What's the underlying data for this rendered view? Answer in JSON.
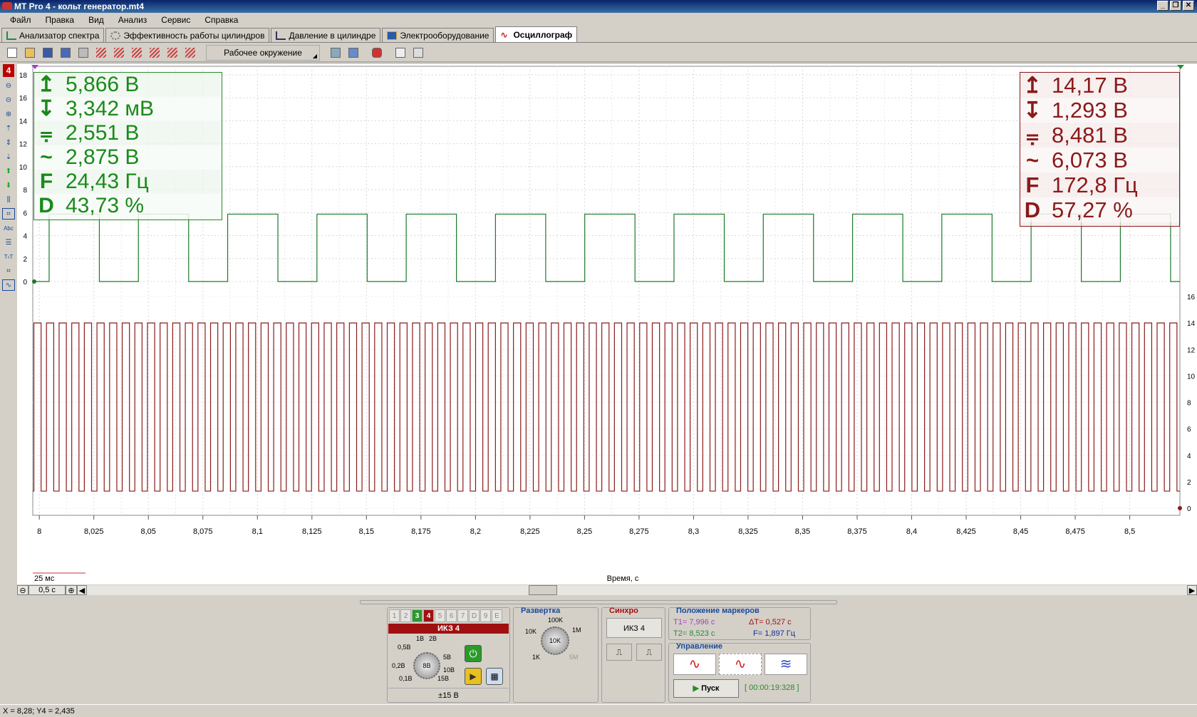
{
  "window": {
    "title": "MT Pro 4 - кольт генератор.mt4",
    "controls": [
      "_",
      "❐",
      "✕"
    ]
  },
  "menu": [
    "Файл",
    "Правка",
    "Вид",
    "Анализ",
    "Сервис",
    "Справка"
  ],
  "tabs": [
    {
      "label": "Анализатор спектра",
      "icon": "spectrum-icon",
      "active": false
    },
    {
      "label": "Эффективность работы цилиндров",
      "icon": "cylinder-efficiency-icon",
      "active": false
    },
    {
      "label": "Давление в цилиндре",
      "icon": "pressure-icon",
      "active": false
    },
    {
      "label": "Электрооборудование",
      "icon": "electrical-icon",
      "active": false
    },
    {
      "label": "Осциллограф",
      "icon": "oscilloscope-icon",
      "active": true
    }
  ],
  "toolbar": {
    "environment": "Рабочее окружение"
  },
  "left_badge": "4",
  "left_tools": [
    "Abc",
    "T‹T"
  ],
  "measure_ch3": {
    "color": "#1a8a1a",
    "rows": [
      {
        "sym": "↕max",
        "value": "5,866 В"
      },
      {
        "sym": "↕min",
        "value": "3,342 мВ"
      },
      {
        "sym": "avg",
        "value": "2,551 В"
      },
      {
        "sym": "~",
        "value": "2,875 В"
      },
      {
        "sym": "F",
        "value": "24,43 Гц"
      },
      {
        "sym": "D",
        "value": "43,73 %"
      }
    ]
  },
  "measure_ch4": {
    "color": "#8b1a1a",
    "rows": [
      {
        "sym": "↕max",
        "value": "14,17 В"
      },
      {
        "sym": "↕min",
        "value": "1,293 В"
      },
      {
        "sym": "avg",
        "value": "8,481 В"
      },
      {
        "sym": "~",
        "value": "6,073 В"
      },
      {
        "sym": "F",
        "value": "172,8 Гц"
      },
      {
        "sym": "D",
        "value": "57,27 %"
      }
    ]
  },
  "chart_data": {
    "type": "line",
    "xlabel": "Время, с",
    "x_ticks": [
      "8",
      "8,025",
      "8,05",
      "8,075",
      "8,1",
      "8,125",
      "8,15",
      "8,175",
      "8,2",
      "8,225",
      "8,25",
      "8,275",
      "8,3",
      "8,325",
      "8,35",
      "8,375",
      "8,4",
      "8,425",
      "8,45",
      "8,475",
      "8,5"
    ],
    "xlim": [
      7.997,
      8.523
    ],
    "y_left_ticks": [
      "0",
      "2",
      "4",
      "6",
      "8",
      "10",
      "12",
      "14",
      "16",
      "18"
    ],
    "y_right_ticks": [
      "0",
      "2",
      "4",
      "6",
      "8",
      "10",
      "12",
      "14",
      "16"
    ],
    "scale_label": "25 мс",
    "grid": true,
    "series": [
      {
        "name": "3",
        "color": "#1a7a2a",
        "low": 0.0,
        "high": 5.87,
        "freq_hz": 24.43,
        "duty": 0.5627,
        "start_x": 8.0045
      },
      {
        "name": "4",
        "color": "#8b1a1a",
        "low": 1.29,
        "high": 14.0,
        "freq_hz": 172.8,
        "duty": 0.5727,
        "start_x": 7.9975
      }
    ]
  },
  "bottom": {
    "zoom": "0,5 с",
    "channels": [
      "1",
      "2",
      "3",
      "4",
      "5",
      "6",
      "7",
      "D",
      "9",
      "E"
    ],
    "channel_name": "ИКЗ 4",
    "volt_labels": [
      "1В",
      "2В",
      "0,5В",
      "5В",
      "0,2В",
      "10В",
      "0,1В",
      "15В"
    ],
    "volt_knob": "8В",
    "range": "±15 В",
    "sweep": {
      "title": "Развертка",
      "labels": [
        "100K",
        "10K",
        "1M",
        "1K",
        "5M"
      ],
      "knob": "10K"
    },
    "sync": {
      "title": "Синхро",
      "source": "ИКЗ 4"
    },
    "markers": {
      "title": "Положение маркеров",
      "t1": "T1= 7,996 с",
      "t2": "T2= 8,523 с",
      "dt": "ΔT= 0,527 с",
      "f": "F= 1,897 Гц"
    },
    "control": {
      "title": "Управление",
      "start": "Пуск",
      "timer": "[ 00:00:19:328 ]"
    }
  },
  "status": "X = 8,28; Y4 = 2,435"
}
